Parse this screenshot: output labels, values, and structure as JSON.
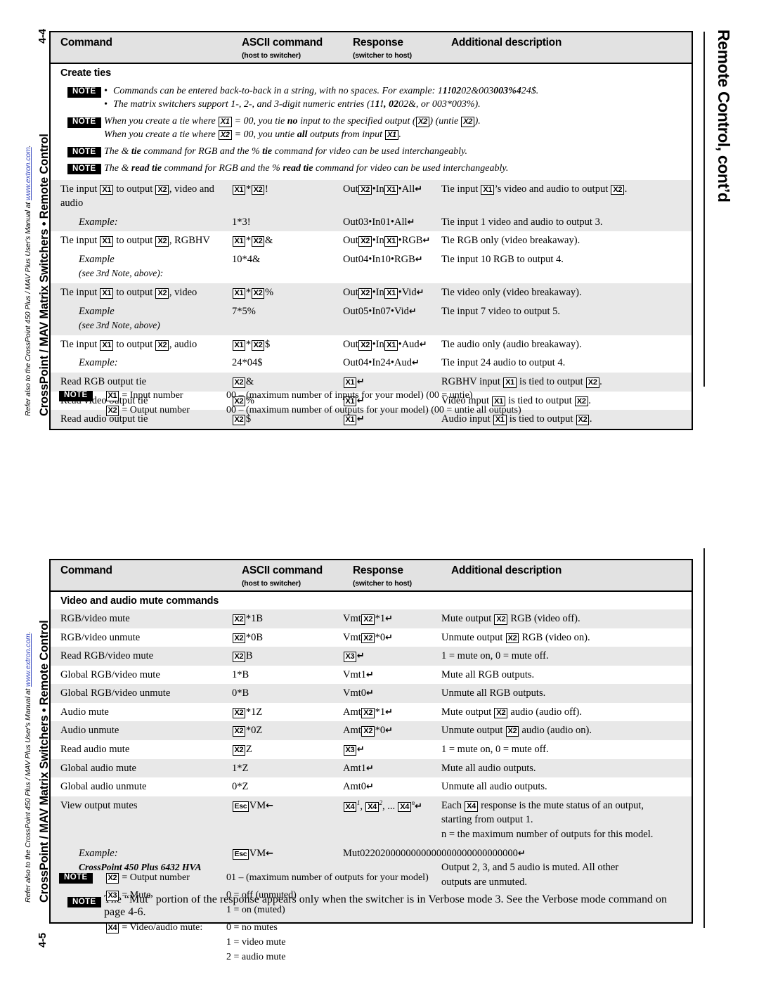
{
  "document": {
    "left_margin_top": {
      "folio": "4-4",
      "title": "CrossPoint / MAV Matrix Switchers • Remote Control",
      "subtitle_pre": "Refer also to the CrossPoint 450 Plus / MAV Plus User's Manual at ",
      "subtitle_url": "www.extron.com",
      "subtitle_post": "."
    },
    "left_margin_bottom": {
      "folio": "4-5",
      "title": "CrossPoint / MAV Matrix Switchers • Remote Control",
      "subtitle_pre": "Refer also to the CrossPoint 450 Plus / MAV Plus User's Manual at ",
      "subtitle_url": "www.extron.com",
      "subtitle_post": "."
    },
    "right_margin": {
      "heading": "Remote Control, cont’d"
    }
  },
  "table_headers": {
    "command": "Command",
    "ascii": "ASCII command",
    "ascii_sub": "(host to switcher)",
    "response": "Response",
    "response_sub": "(switcher to host)",
    "description": "Additional description"
  },
  "table1": {
    "section_title": "Create ties",
    "badge_note": "NOTE",
    "notes": [
      {
        "bullets": [
          "Commands can be entered back-to-back in a string, with no spaces.  For example: 1*1!02*02&003*003%4*24$.",
          "The matrix switchers support 1-, 2-, and 3-digit numeric entries (1*1!, 02*02&, or 003*003%)."
        ]
      },
      {
        "lines": [
          "When you create a tie where |X1| = 00, you tie *no* input to the specified output (|X2|) (untie |X2|).",
          "When you create a tie where |X2| = 00, you untie *all* outputs from input |X1|."
        ]
      },
      {
        "lines": [
          "The & *tie* command for RGB and the % *tie* command for video can be used interchangeably."
        ]
      },
      {
        "lines": [
          "The & *read tie* command for RGB and the % *read tie* command for video can be used interchangeably."
        ]
      }
    ],
    "rows": [
      {
        "shade": true,
        "command": "Tie input |X1| to output |X2|, video and audio",
        "ascii": "|X1|*|X2|!",
        "response": "Out|X2|•In|X1|•All↵",
        "description": "Tie input |X1|’s video and audio to output |X2|."
      },
      {
        "shade": true,
        "indent": true,
        "command_italic": "Example:",
        "ascii": "1*3!",
        "response": "Out03•In01•All↵",
        "description": "Tie input 1 video and audio to output 3."
      },
      {
        "shade": false,
        "command": "Tie input |X1| to output |X2|, RGBHV",
        "ascii": "|X1|*|X2|&",
        "response": "Out|X2|•In|X1|•RGB↵",
        "description": "Tie RGB only (video breakaway)."
      },
      {
        "shade": false,
        "indent": true,
        "command_italic": "Example",
        "command_italic2": "(see 3rd Note, above):",
        "ascii": "10*4&",
        "response": "Out04•In10•RGB↵",
        "description": "Tie input 10 RGB to output 4."
      },
      {
        "shade": true,
        "command": "Tie input |X1| to output |X2|, video",
        "ascii": "|X1|*|X2|%",
        "response": "Out|X2|•In|X1|•Vid↵",
        "description": "Tie video only (video breakaway)."
      },
      {
        "shade": true,
        "indent": true,
        "command_italic": "Example",
        "command_italic2": "(see 3rd Note, above)",
        "ascii": "7*5%",
        "response": "Out05•In07•Vid↵",
        "description": "Tie input 7 video to output 5."
      },
      {
        "shade": false,
        "command": "Tie input |X1| to output |X2|, audio",
        "ascii": "|X1|*|X2|$",
        "response": "Out|X2|•In|X1|•Aud↵",
        "description": "Tie audio only (audio breakaway)."
      },
      {
        "shade": false,
        "indent": true,
        "command_italic": "Example:",
        "ascii": "24*04$",
        "response": "Out04•In24•Aud↵",
        "description": "Tie input 24 audio to output 4."
      },
      {
        "shade": true,
        "command": "Read RGB output tie",
        "ascii": "|X2|&",
        "response": "|X1|↵",
        "description": "RGBHV input |X1| is tied to output |X2|."
      },
      {
        "shade": false,
        "command": "Read video output tie",
        "ascii": "|X2|%",
        "response": "|X1|↵",
        "description": "Video input |X1| is tied to output |X2|."
      },
      {
        "shade": true,
        "command": "Read audio output tie",
        "ascii": "|X2|$",
        "response": "|X1|↵",
        "description": "Audio input |X1| is tied to output |X2|."
      }
    ],
    "footer_note": {
      "badge": "NOTE",
      "defs": [
        {
          "key": "|X1| = Input number",
          "value": "00 – (maximum number of inputs for your model)  (00 = untie)"
        },
        {
          "key": "|X2| = Output number",
          "value": "00 – (maximum number of outputs for your model)  (00 = untie all outputs)"
        }
      ]
    }
  },
  "table2": {
    "section_title": "Video and audio mute commands",
    "rows": [
      {
        "shade": true,
        "command": "RGB/video mute",
        "ascii": "|X2|*1B",
        "response": "Vmt|X2|*1↵",
        "description": "Mute output |X2| RGB (video off)."
      },
      {
        "shade": false,
        "command": "RGB/video unmute",
        "ascii": "|X2|*0B",
        "response": "Vmt|X2|*0↵",
        "description": "Unmute output |X2| RGB (video on)."
      },
      {
        "shade": true,
        "command": "Read RGB/video mute",
        "ascii": "|X2|B",
        "response": "|X3|↵",
        "description": "1 = mute on, 0 = mute off."
      },
      {
        "shade": false,
        "command": "Global RGB/video mute",
        "ascii": "1*B",
        "response": "Vmt1↵",
        "description": "Mute all RGB outputs."
      },
      {
        "shade": true,
        "command": "Global RGB/video unmute",
        "ascii": "0*B",
        "response": "Vmt0↵",
        "description": "Unmute all RGB outputs."
      },
      {
        "shade": false,
        "command": "Audio mute",
        "ascii": "|X2|*1Z",
        "response": "Amt|X2|*1↵",
        "description": "Mute output |X2| audio (audio off)."
      },
      {
        "shade": true,
        "command": "Audio unmute",
        "ascii": "|X2|*0Z",
        "response": "Amt|X2|*0↵",
        "description": "Unmute output |X2| audio (audio on)."
      },
      {
        "shade": false,
        "command": "Read audio mute",
        "ascii": "|X2|Z",
        "response": "|X3|↵",
        "description": "1 = mute on, 0 = mute off."
      },
      {
        "shade": true,
        "command": "Global audio mute",
        "ascii": "1*Z",
        "response": "Amt1↵",
        "description": "Mute all audio outputs."
      },
      {
        "shade": false,
        "command": "Global audio unmute",
        "ascii": "0*Z",
        "response": "Amt0↵",
        "description": "Unmute all audio outputs."
      }
    ],
    "view_output_mutes": {
      "shade": true,
      "command": "View output mutes",
      "ascii": "|Esc|VM←",
      "response": "|X4|^1, |X4|^2, ... |X4|^n↵",
      "description_line1": "Each |X4| response is the mute status of an output,",
      "description_line2": "starting from output 1.",
      "description_line3": "*n* = the maximum number of outputs for this model."
    },
    "example": {
      "shade": true,
      "command_italic": "Example:",
      "command_bold_italic": "CrossPoint 450 Plus 6432 HVA",
      "ascii": "|Esc|VM←",
      "response": "Mut0220200000000000000000000000000↵",
      "description_line1": "Output 2, 3, and 5 audio is muted.  All other",
      "description_line2": "outputs are unmuted."
    },
    "inline_note": {
      "badge": "NOTE",
      "text": "The “Mut” portion of the response appears only when the switcher is in Verbose mode 3.  See the Verbose mode command on page 4-6."
    },
    "footer_note": {
      "badge": "NOTE",
      "defs": [
        {
          "key": "|X2| = Output number",
          "values": [
            "01 – (maximum number of outputs for your model)"
          ]
        },
        {
          "key": "|X3| = Mute",
          "values": [
            "0 = off (unmuted)",
            "1 = on (muted)"
          ]
        },
        {
          "key": "|X4| = Video/audio mute:",
          "values": [
            "0 = no mutes",
            "1 = video mute",
            "2 = audio mute"
          ]
        }
      ]
    }
  }
}
